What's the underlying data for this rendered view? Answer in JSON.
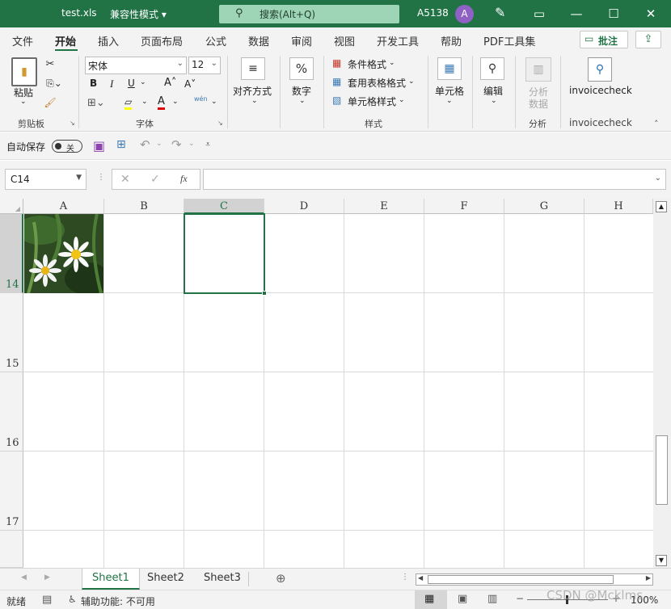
{
  "title": {
    "filename": "test.xls",
    "mode": "兼容性模式 ▾",
    "search": "搜索(Alt+Q)",
    "user": "A5138",
    "avatar": "A"
  },
  "tabs": [
    "文件",
    "开始",
    "插入",
    "页面布局",
    "公式",
    "数据",
    "审阅",
    "视图",
    "开发工具",
    "帮助",
    "PDF工具集"
  ],
  "comments_button": "批注",
  "ribbon": {
    "clipboard": {
      "paste": "粘贴",
      "group": "剪贴板"
    },
    "font": {
      "name": "宋体",
      "size": "12",
      "group": "字体",
      "bold": "B",
      "italic": "I",
      "underline": "U",
      "wen": "wén"
    },
    "align": {
      "label": "对齐方式"
    },
    "number": {
      "label": "数字"
    },
    "styles": {
      "cond": "条件格式",
      "table": "套用表格格式",
      "cell": "单元格样式",
      "group": "样式"
    },
    "cells": {
      "label": "单元格"
    },
    "edit": {
      "label": "编辑"
    },
    "analysis": {
      "label1": "分析",
      "label2": "数据",
      "group": "分析"
    },
    "invoice": {
      "label": "invoicecheck",
      "group": "invoicecheck"
    }
  },
  "qat": {
    "autosave": "自动保存",
    "toggle": "关"
  },
  "formula": {
    "namebox": "C14",
    "fx": "fx",
    "value": ""
  },
  "columns": [
    "A",
    "B",
    "C",
    "D",
    "E",
    "F",
    "G",
    "H"
  ],
  "rows": [
    "14",
    "15",
    "16",
    "17"
  ],
  "selected_cell": "C14",
  "sheets": [
    "Sheet1",
    "Sheet2",
    "Sheet3"
  ],
  "status": {
    "ready": "就绪",
    "accessibility": "辅助功能: 不可用",
    "zoom": "100%"
  },
  "watermark": "CSDN @Mcklms",
  "colors": {
    "accent": "#217346",
    "title_bar": "#217346"
  }
}
